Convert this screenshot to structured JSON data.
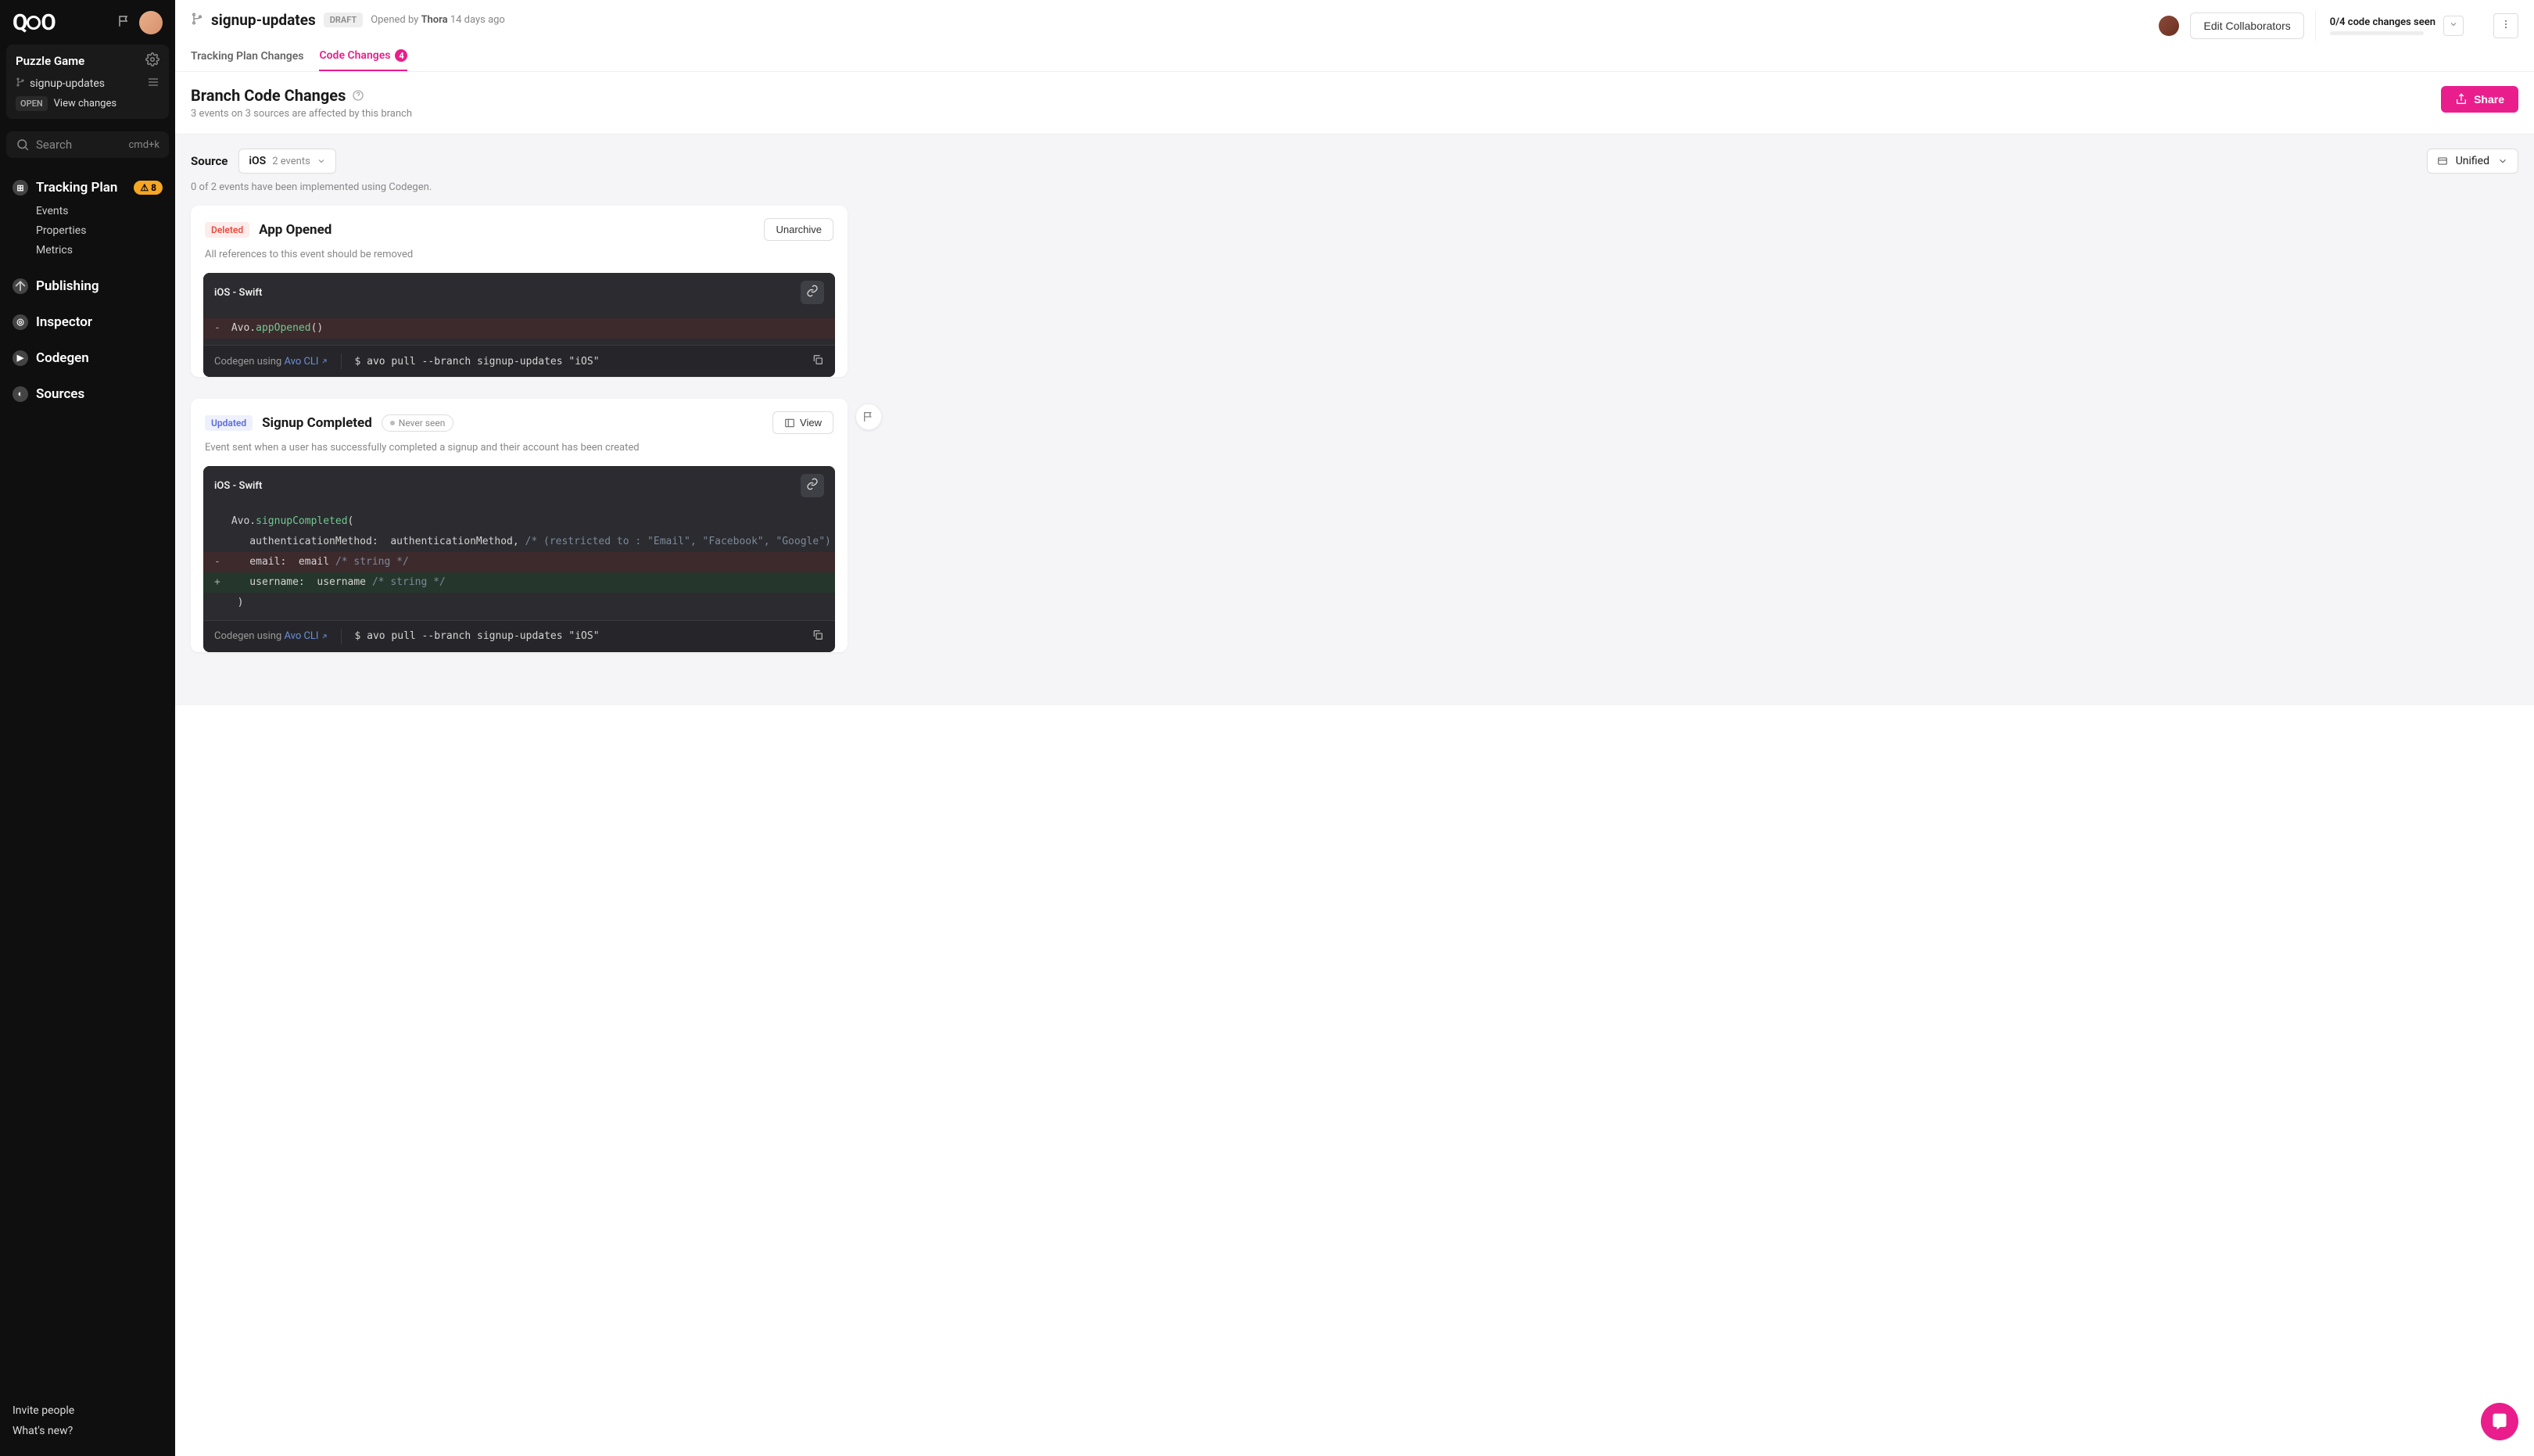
{
  "workspace": {
    "name": "Puzzle Game"
  },
  "branch": {
    "name": "signup-updates",
    "status_chip": "OPEN",
    "view_changes": "View changes",
    "draft": "DRAFT",
    "opened_by_prefix": "Opened by ",
    "opened_by_name": "Thora",
    "opened_by_suffix": " 14 days ago"
  },
  "search": {
    "placeholder": "Search",
    "shortcut": "cmd+k"
  },
  "nav": {
    "tracking_plan": "Tracking Plan",
    "tracking_plan_badge": "8",
    "events": "Events",
    "properties": "Properties",
    "metrics": "Metrics",
    "publishing": "Publishing",
    "inspector": "Inspector",
    "codegen": "Codegen",
    "sources": "Sources"
  },
  "footer": {
    "invite": "Invite people",
    "whatsnew": "What's new?"
  },
  "topbar": {
    "edit_collab": "Edit Collaborators",
    "seen": "0/4 code changes seen"
  },
  "tabs": {
    "tracking": "Tracking Plan Changes",
    "code": "Code Changes",
    "code_badge": "4"
  },
  "page": {
    "title": "Branch Code Changes",
    "sub": "3 events on 3 sources are affected by this branch",
    "share": "Share"
  },
  "source_row": {
    "label": "Source",
    "platform": "iOS",
    "count": "2 events",
    "view_mode": "Unified",
    "impl_note": "0 of 2 events have been implemented using Codegen."
  },
  "cards": [
    {
      "chip": "Deleted",
      "chip_class": "chip-del",
      "name": "App Opened",
      "action": "Unarchive",
      "desc": "All references to this event should be removed",
      "code_lang": "iOS - Swift",
      "code_lines": [
        {
          "type": "del",
          "sign": "-",
          "pre": " Avo.",
          "fn": "appOpened",
          "post": "()"
        }
      ],
      "codegen_using": "Codegen using ",
      "codegen_link": "Avo CLI",
      "cmd": "$ avo pull --branch signup-updates \"iOS\""
    },
    {
      "chip": "Updated",
      "chip_class": "chip-upd",
      "name": "Signup Completed",
      "never": "Never seen",
      "action": "View",
      "desc": "Event sent when a user has successfully completed a signup and their account has been created",
      "code_lang": "iOS - Swift",
      "code_lines": [
        {
          "type": "",
          "sign": "",
          "pre": " Avo.",
          "fn": "signupCompleted",
          "post": "("
        },
        {
          "type": "",
          "sign": "",
          "pre": "    authenticationMethod:  authenticationMethod, ",
          "comment": "/* (restricted to : \"Email\", \"Facebook\", \"Google\") */"
        },
        {
          "type": "del",
          "sign": "-",
          "pre": "    email:  email ",
          "comment": "/* string */"
        },
        {
          "type": "add",
          "sign": "+",
          "pre": "    username:  username ",
          "comment": "/* string */"
        },
        {
          "type": "",
          "sign": "",
          "pre": "  )"
        }
      ],
      "codegen_using": "Codegen using ",
      "codegen_link": "Avo CLI",
      "cmd": "$ avo pull --branch signup-updates \"iOS\"",
      "has_comment_bubble": true
    }
  ]
}
